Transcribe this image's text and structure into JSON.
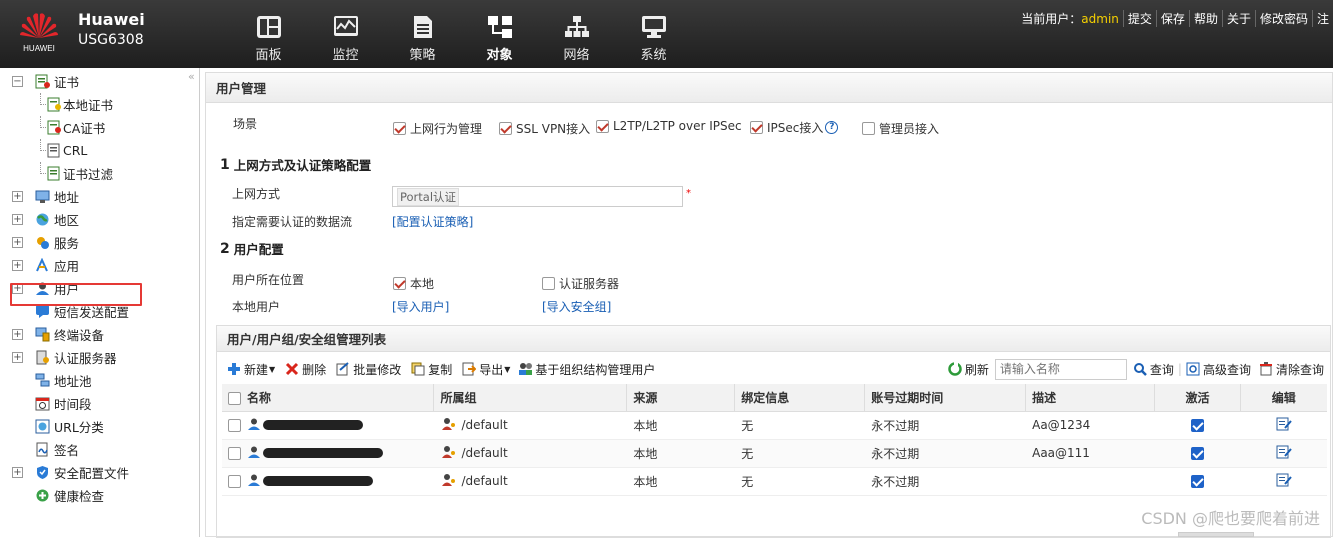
{
  "brand": {
    "name": "Huawei",
    "model": "USG6308",
    "logo_text": "HUAWEI"
  },
  "nav": [
    {
      "label": "面板",
      "icon": "dashboard-icon"
    },
    {
      "label": "监控",
      "icon": "monitor-icon"
    },
    {
      "label": "策略",
      "icon": "policy-icon"
    },
    {
      "label": "对象",
      "icon": "object-icon",
      "active": true
    },
    {
      "label": "网络",
      "icon": "network-icon"
    },
    {
      "label": "系统",
      "icon": "system-icon"
    }
  ],
  "toplinks": {
    "user_label": "当前用户：",
    "user_name": "admin",
    "submit": "提交",
    "save": "保存",
    "help": "帮助",
    "about": "关于",
    "change_pw": "修改密码",
    "logout": "注"
  },
  "sidebar": {
    "collapse": "«",
    "items": [
      {
        "label": "证书",
        "expanded": true,
        "icon": "certificate-icon"
      },
      {
        "label": "本地证书",
        "icon": "local-cert-icon"
      },
      {
        "label": "CA证书",
        "icon": "ca-cert-icon"
      },
      {
        "label": "CRL",
        "icon": "crl-icon"
      },
      {
        "label": "证书过滤",
        "icon": "cert-filter-icon"
      },
      {
        "label": "地址",
        "icon": "address-icon"
      },
      {
        "label": "地区",
        "icon": "region-icon"
      },
      {
        "label": "服务",
        "icon": "service-icon"
      },
      {
        "label": "应用",
        "icon": "application-icon"
      },
      {
        "label": "用户",
        "icon": "user-icon",
        "selected": true
      },
      {
        "label": "短信发送配置",
        "icon": "sms-icon"
      },
      {
        "label": "终端设备",
        "icon": "terminal-icon"
      },
      {
        "label": "认证服务器",
        "icon": "auth-server-icon"
      },
      {
        "label": "地址池",
        "icon": "address-pool-icon"
      },
      {
        "label": "时间段",
        "icon": "time-range-icon"
      },
      {
        "label": "URL分类",
        "icon": "url-category-icon"
      },
      {
        "label": "签名",
        "icon": "signature-icon"
      },
      {
        "label": "安全配置文件",
        "icon": "security-profile-icon"
      },
      {
        "label": "健康检查",
        "icon": "health-check-icon"
      }
    ]
  },
  "main": {
    "title": "用户管理",
    "scene": {
      "label": "场景",
      "options": [
        {
          "label": "上网行为管理",
          "checked": true
        },
        {
          "label": "SSL VPN接入",
          "checked": true
        },
        {
          "label": "L2TP/L2TP over IPSec",
          "checked": true
        },
        {
          "label": "IPSec接入",
          "checked": true
        },
        {
          "label": "管理员接入",
          "checked": false
        }
      ]
    },
    "section1": {
      "num": "1",
      "title": "上网方式及认证策略配置"
    },
    "access_mode": {
      "label": "上网方式",
      "value": "Portal认证",
      "required": "*"
    },
    "auth_flow": {
      "label": "指定需要认证的数据流",
      "link": "[配置认证策略]"
    },
    "section2": {
      "num": "2",
      "title": "用户配置"
    },
    "user_location": {
      "label": "用户所在位置",
      "local": "本地",
      "local_checked": true,
      "server": "认证服务器",
      "server_checked": false
    },
    "local_user": {
      "label": "本地用户",
      "import_users": "[导入用户]",
      "import_groups": "[导入安全组]"
    }
  },
  "list": {
    "title": "用户/用户组/安全组管理列表",
    "toolbar": {
      "new": "新建",
      "delete": "删除",
      "batch_edit": "批量修改",
      "copy": "复制",
      "export": "导出",
      "org_manage": "基于组织结构管理用户",
      "refresh": "刷新",
      "search_placeholder": "请输入名称",
      "query": "查询",
      "advanced": "高级查询",
      "clear": "清除查询"
    },
    "columns": [
      "名称",
      "所属组",
      "来源",
      "绑定信息",
      "账号过期时间",
      "描述",
      "激活",
      "编辑"
    ],
    "rows": [
      {
        "group": "/default",
        "source": "本地",
        "binding": "无",
        "expire": "永不过期",
        "desc": "Aa@1234",
        "active": true
      },
      {
        "group": "/default",
        "source": "本地",
        "binding": "无",
        "expire": "永不过期",
        "desc": "Aaa@111",
        "active": true
      },
      {
        "group": "/default",
        "source": "本地",
        "binding": "无",
        "expire": "永不过期",
        "desc": "",
        "active": true
      }
    ]
  },
  "watermark": "CSDN @爬也要爬着前进"
}
